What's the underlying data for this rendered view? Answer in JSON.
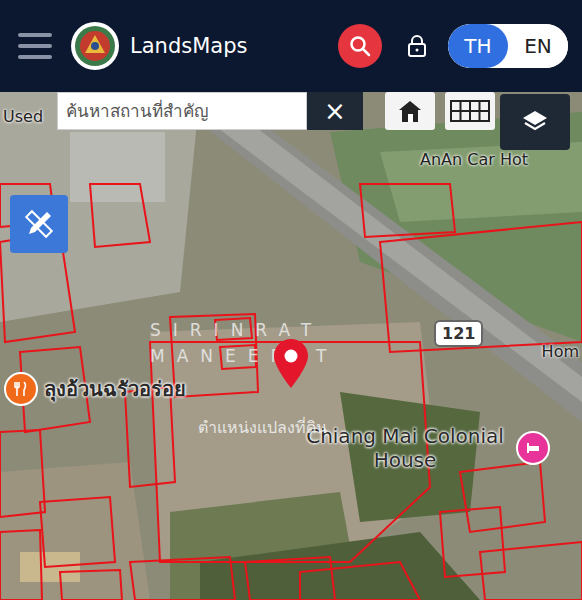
{
  "header": {
    "app_name": "LandsMaps",
    "languages": [
      {
        "label": "TH",
        "selected": true
      },
      {
        "label": "EN",
        "selected": false
      }
    ]
  },
  "search": {
    "placeholder": "ค้นหาสถานที่สำคัญ",
    "clear": "×"
  },
  "map": {
    "watermark": [
      "SIRINRAT",
      "MANEERAT"
    ],
    "road_shield": "121",
    "pin_label": "ตำแหน่งแปลงที่ดิน",
    "places": [
      {
        "text": "ลุงอ้วนฉรัวอร่อย",
        "color": "#f06a1a"
      },
      {
        "text": "Chiang Mai Colonial House",
        "color": "#e8339a"
      }
    ],
    "edge_labels": [
      "Used",
      "AnAn Car Hot",
      "Hom"
    ]
  }
}
